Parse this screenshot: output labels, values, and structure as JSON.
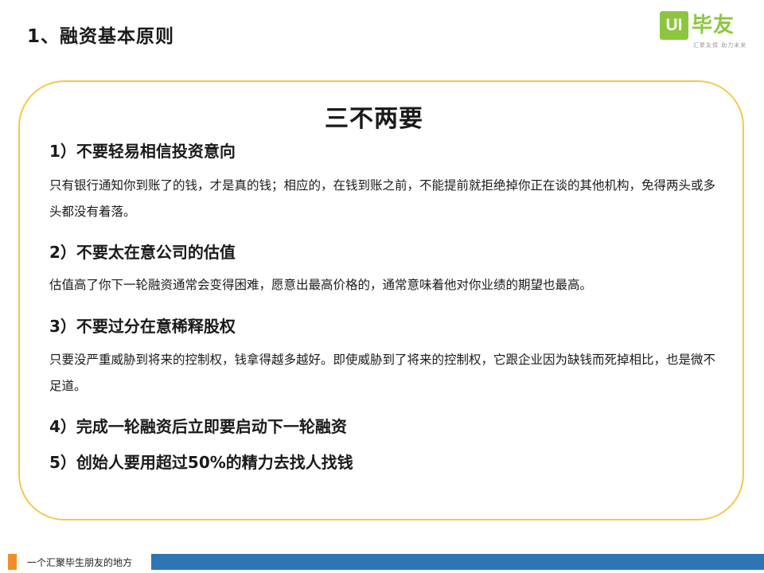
{
  "slide": {
    "title": "1、融资基本原则"
  },
  "logo": {
    "mark": "UI",
    "name": "毕友",
    "tagline": "汇聚友情 助力未来",
    "brand_color": "#8cc63f"
  },
  "panel": {
    "heading": "三不两要",
    "border_color": "#f2c94c",
    "items": [
      {
        "title": "1）不要轻易相信投资意向",
        "body": "只有银行通知你到账了的钱，才是真的钱；相应的，在钱到账之前，不能提前就拒绝掉你正在谈的其他机构，免得两头或多头都没有着落。"
      },
      {
        "title": "2）不要太在意公司的估值",
        "body": "估值高了你下一轮融资通常会变得困难，愿意出最高价格的，通常意味着他对你业绩的期望也最高。"
      },
      {
        "title": "3）不要过分在意稀释股权",
        "body": "只要没严重威胁到将来的控制权，钱拿得越多越好。即使威胁到了将来的控制权，它跟企业因为缺钱而死掉相比，也是微不足道。"
      },
      {
        "title": "4）完成一轮融资后立即要启动下一轮融资"
      },
      {
        "title": "5）创始人要用超过50%的精力去找人找钱"
      }
    ]
  },
  "footer": {
    "text": "一个汇聚毕生朋友的地方",
    "accent_color": "#f28c28",
    "bar_color": "#2e75b6"
  }
}
